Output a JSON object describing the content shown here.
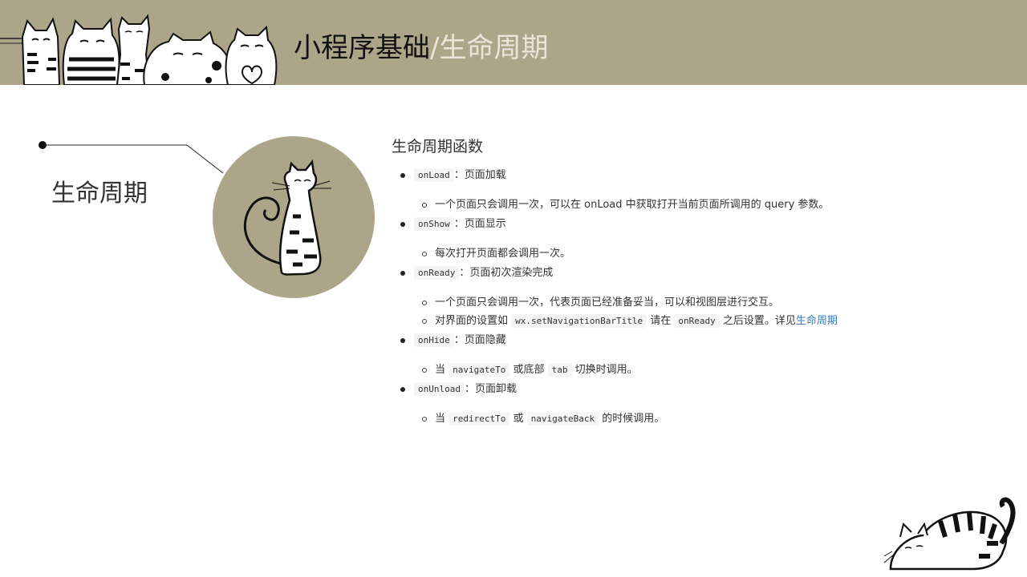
{
  "header": {
    "title_main": "小程序基础",
    "title_separator": "/",
    "title_sub": "生命周期",
    "bg_color": "#ada58a"
  },
  "section": {
    "label": "生命周期"
  },
  "content": {
    "heading": "生命周期函数",
    "items": [
      {
        "code": "onLoad",
        "desc": "：页面加载",
        "sub": [
          {
            "text": "一个页面只会调用一次，可以在 onLoad 中获取打开当前页面所调用的 query 参数。"
          }
        ]
      },
      {
        "code": "onShow",
        "desc": "：页面显示",
        "sub": [
          {
            "text": "每次打开页面都会调用一次。"
          }
        ]
      },
      {
        "code": "onReady",
        "desc": "：页面初次渲染完成",
        "sub": [
          {
            "text": "一个页面只会调用一次，代表页面已经准备妥当，可以和视图层进行交互。"
          },
          {
            "pre": "对界面的设置如 ",
            "code1": "wx.setNavigationBarTitle",
            "mid": " 请在 ",
            "code2": "onReady",
            "post": " 之后设置。详见",
            "link": "生命周期"
          }
        ]
      },
      {
        "code": "onHide",
        "desc": "：页面隐藏",
        "sub": [
          {
            "pre": "当 ",
            "code1": "navigateTo",
            "mid": " 或底部 ",
            "code2": "tab",
            "post": " 切换时调用。"
          }
        ]
      },
      {
        "code": "onUnload",
        "desc": "：页面卸载",
        "sub": [
          {
            "pre": "当 ",
            "code1": "redirectTo",
            "mid": " 或 ",
            "code2": "navigateBack",
            "post": " 的时候调用。"
          }
        ]
      }
    ]
  }
}
